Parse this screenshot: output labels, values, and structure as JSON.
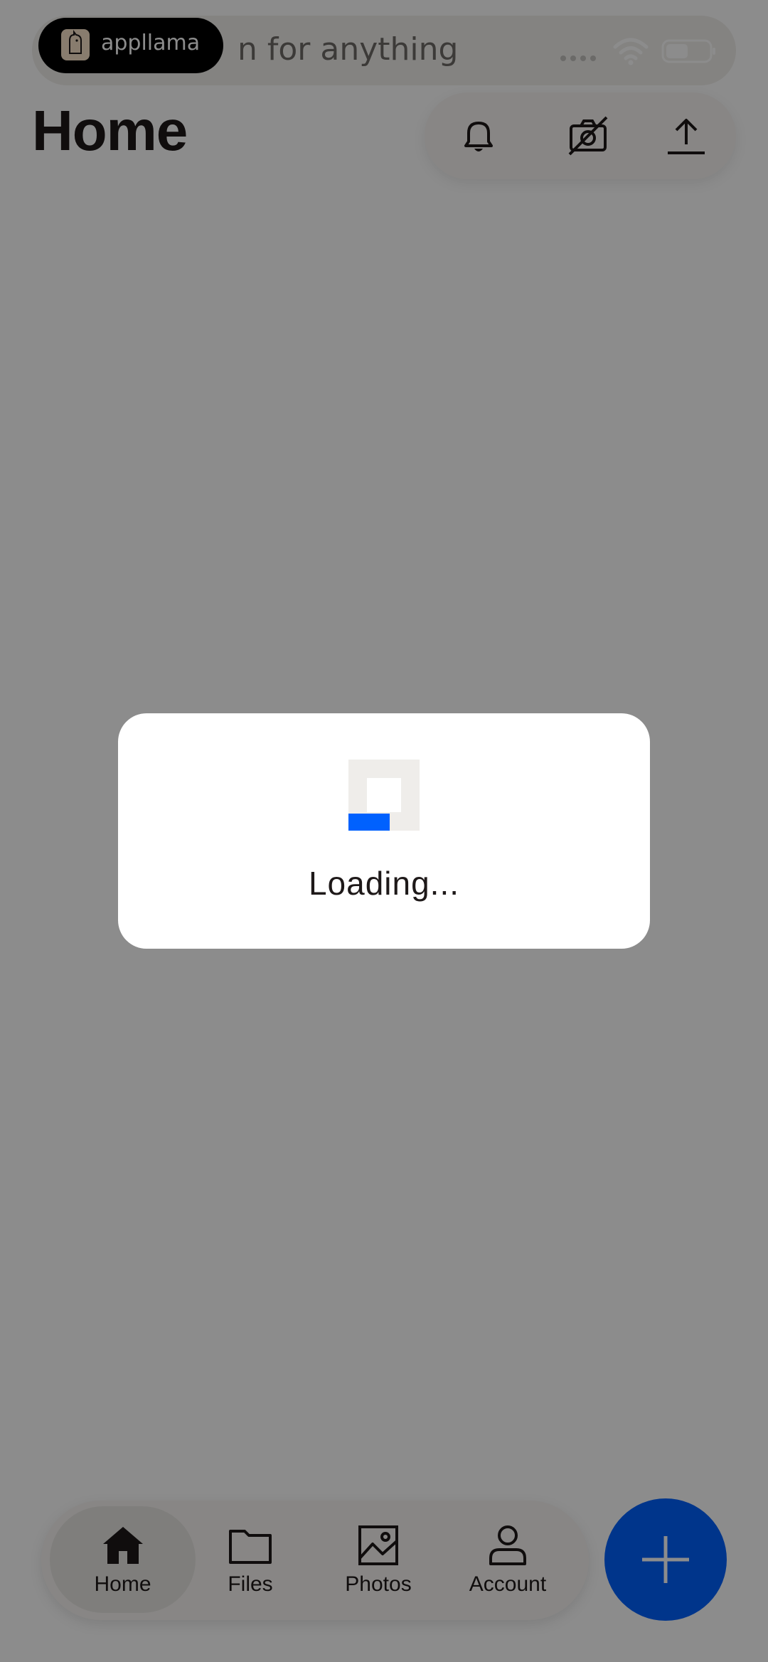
{
  "status_bar": {
    "brand": "appllama",
    "search_text": "n for anything"
  },
  "header": {
    "title": "Home",
    "actions": [
      "bell-icon",
      "camera-off-icon",
      "upload-icon"
    ]
  },
  "bottom_nav": {
    "items": [
      {
        "label": "Home",
        "icon": "home-icon",
        "active": true
      },
      {
        "label": "Files",
        "icon": "folder-icon",
        "active": false
      },
      {
        "label": "Photos",
        "icon": "photo-icon",
        "active": false
      },
      {
        "label": "Account",
        "icon": "account-icon",
        "active": false
      }
    ],
    "fab_icon": "plus-icon"
  },
  "loading": {
    "text": "Loading..."
  },
  "colors": {
    "accent": "#0061fe",
    "scrim": "rgba(0,0,0,0.45)",
    "spinner_track": "#efedea"
  }
}
